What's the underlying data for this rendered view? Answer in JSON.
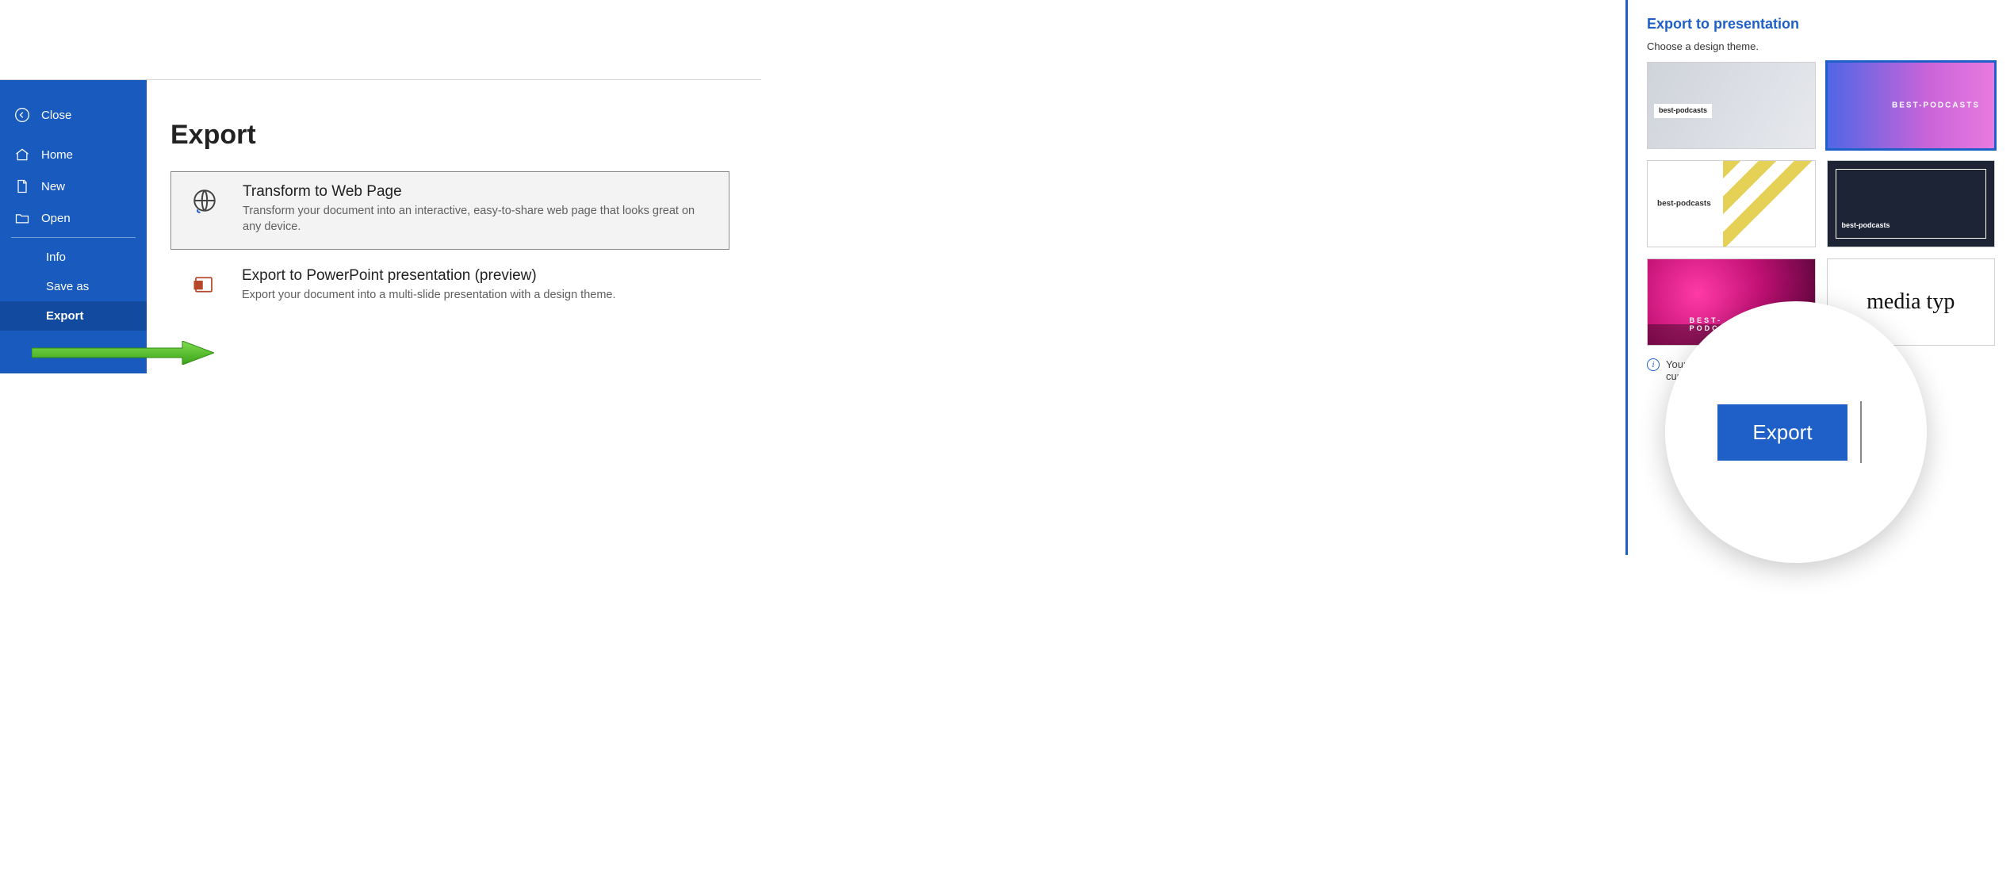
{
  "sidebar": {
    "close": "Close",
    "home": "Home",
    "new": "New",
    "open": "Open",
    "info": "Info",
    "save_as": "Save as",
    "export": "Export"
  },
  "page": {
    "title": "Export"
  },
  "options": {
    "web": {
      "title": "Transform to Web Page",
      "desc": "Transform your document into an interactive, easy-to-share web page that looks great on any device."
    },
    "ppt": {
      "title": "Export to PowerPoint presentation (preview)",
      "desc": "Export your document into a multi-slide presentation with a design theme."
    }
  },
  "panel": {
    "title": "Export to presentation",
    "subtitle": "Choose a design theme.",
    "notice_line1": "Your text will be included in t",
    "notice_line2": "currently not supported.",
    "export_button": "Export",
    "themes": {
      "t1": "best-podcasts",
      "t2": "BEST-PODCASTS",
      "t3": "best-podcasts",
      "t4": "best-podcasts",
      "t5": "BEST-PODCASTS",
      "t6": "media typ"
    }
  }
}
